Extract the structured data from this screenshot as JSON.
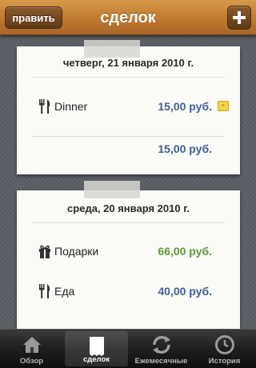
{
  "navbar": {
    "edit_label": "править",
    "title": "сделок"
  },
  "cards": [
    {
      "date": "четверг, 21 января 2010 г.",
      "rows": [
        {
          "icon": "fork-knife-icon",
          "label": "Dinner",
          "amount": "15,00 руб.",
          "color": "#3d5f9a"
        }
      ],
      "total": "15,00 руб."
    },
    {
      "date": "среда, 20 января 2010 г.",
      "rows": [
        {
          "icon": "gift-icon",
          "label": "Подарки",
          "amount": "66,00 руб.",
          "color": "#5c9a3a"
        },
        {
          "icon": "fork-knife-icon",
          "label": "Еда",
          "amount": "40,00 руб.",
          "color": "#3d5f9a"
        }
      ]
    }
  ],
  "tabs": [
    {
      "label": "Обзор",
      "icon": "house-icon"
    },
    {
      "label": "сделок",
      "icon": "receipt-icon",
      "active": true
    },
    {
      "label": "Ежемесячные",
      "icon": "repeat-icon"
    },
    {
      "label": "История",
      "icon": "clock-icon"
    }
  ]
}
